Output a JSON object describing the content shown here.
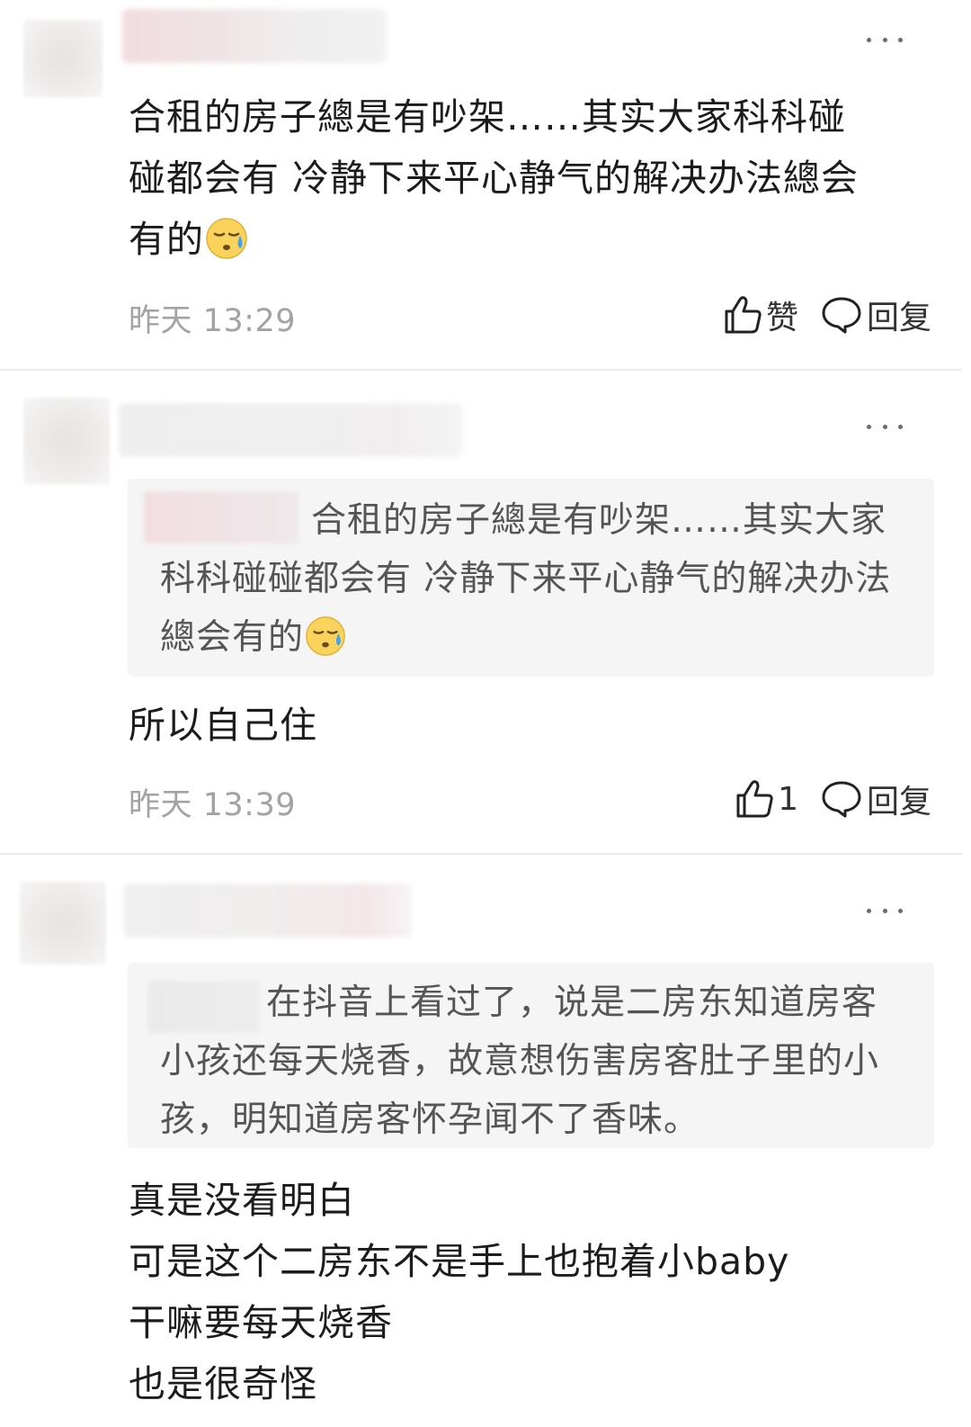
{
  "comments": [
    {
      "text": "合租的房子總是有吵架……其实大家科科碰\n碰都会有 冷静下来平心静气的解决办法總会\n有的",
      "time": "昨天 13:29",
      "like_label": "赞",
      "reply_label": "回复",
      "emoji": "downcast-sweat-face"
    },
    {
      "quote": "合租的房子總是有吵架……其实大家科科碰碰都会有 冷静下来平心静气的解决办法總会有的",
      "text": "所以自己住",
      "time": "昨天 13:39",
      "like_count": "1",
      "reply_label": "回复",
      "emoji": "downcast-sweat-face"
    },
    {
      "quote": "在抖音上看过了，说是二房东知道房客小孩还每天烧香，故意想伤害房客肚子里的小孩，明知道房客怀孕闻不了香味。",
      "text": "真是没看明白\n可是这个二房东不是手上也抱着小baby\n干嘛要每天烧香\n也是很奇怪"
    }
  ],
  "icons": {
    "like": "thumbs-up-icon",
    "reply": "speech-bubble-icon",
    "more": "more-dots-icon"
  },
  "colors": {
    "text": "#1c1c1c",
    "quote_bg": "#f5f5f5",
    "quote_text": "#555555",
    "time": "#a3a3a3"
  }
}
